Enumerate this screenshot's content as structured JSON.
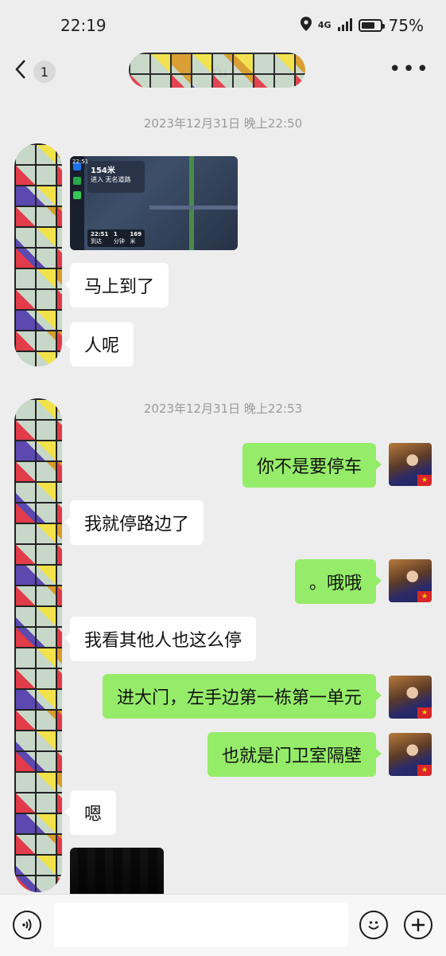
{
  "status_bar": {
    "time": "22:19",
    "network": "4G",
    "battery": "75%",
    "battery_level": 0.75
  },
  "header": {
    "back_count": "1",
    "title": "Yu",
    "more": "•••"
  },
  "messages": [
    {
      "type": "timestamp",
      "text": "2023年12月31日 晚上22:50"
    },
    {
      "type": "image",
      "side": "in",
      "nav": {
        "time": "22:51",
        "distance": "154米",
        "road": "进入 无名道路",
        "eta_time": "22:51",
        "eta_label": "到达",
        "minutes": "1",
        "minutes_label": "分钟",
        "meters": "169",
        "meters_label": "米"
      }
    },
    {
      "type": "text",
      "side": "in",
      "text": "马上到了"
    },
    {
      "type": "text",
      "side": "in",
      "text": "人呢"
    },
    {
      "type": "timestamp",
      "text": "2023年12月31日 晚上22:53"
    },
    {
      "type": "text",
      "side": "out",
      "text": "你不是要停车"
    },
    {
      "type": "text",
      "side": "in",
      "text": "我就停路边了"
    },
    {
      "type": "text",
      "side": "out",
      "text": "。哦哦"
    },
    {
      "type": "text",
      "side": "in",
      "text": "我看其他人也这么停"
    },
    {
      "type": "text",
      "side": "out",
      "text": "进大门，左手边第一栋第一单元"
    },
    {
      "type": "text",
      "side": "out",
      "text": "也就是门卫室隔壁"
    },
    {
      "type": "text",
      "side": "in",
      "text": "嗯"
    },
    {
      "type": "image",
      "side": "in"
    }
  ],
  "input_bar": {
    "value": "",
    "placeholder": ""
  },
  "colors": {
    "background": "#ededed",
    "bubble_in": "#ffffff",
    "bubble_out": "#95ec69"
  },
  "icons": [
    "back-arrow-icon",
    "more-icon",
    "voice-icon",
    "emoji-icon",
    "plus-icon",
    "location-icon",
    "signal-icon",
    "battery-icon"
  ]
}
